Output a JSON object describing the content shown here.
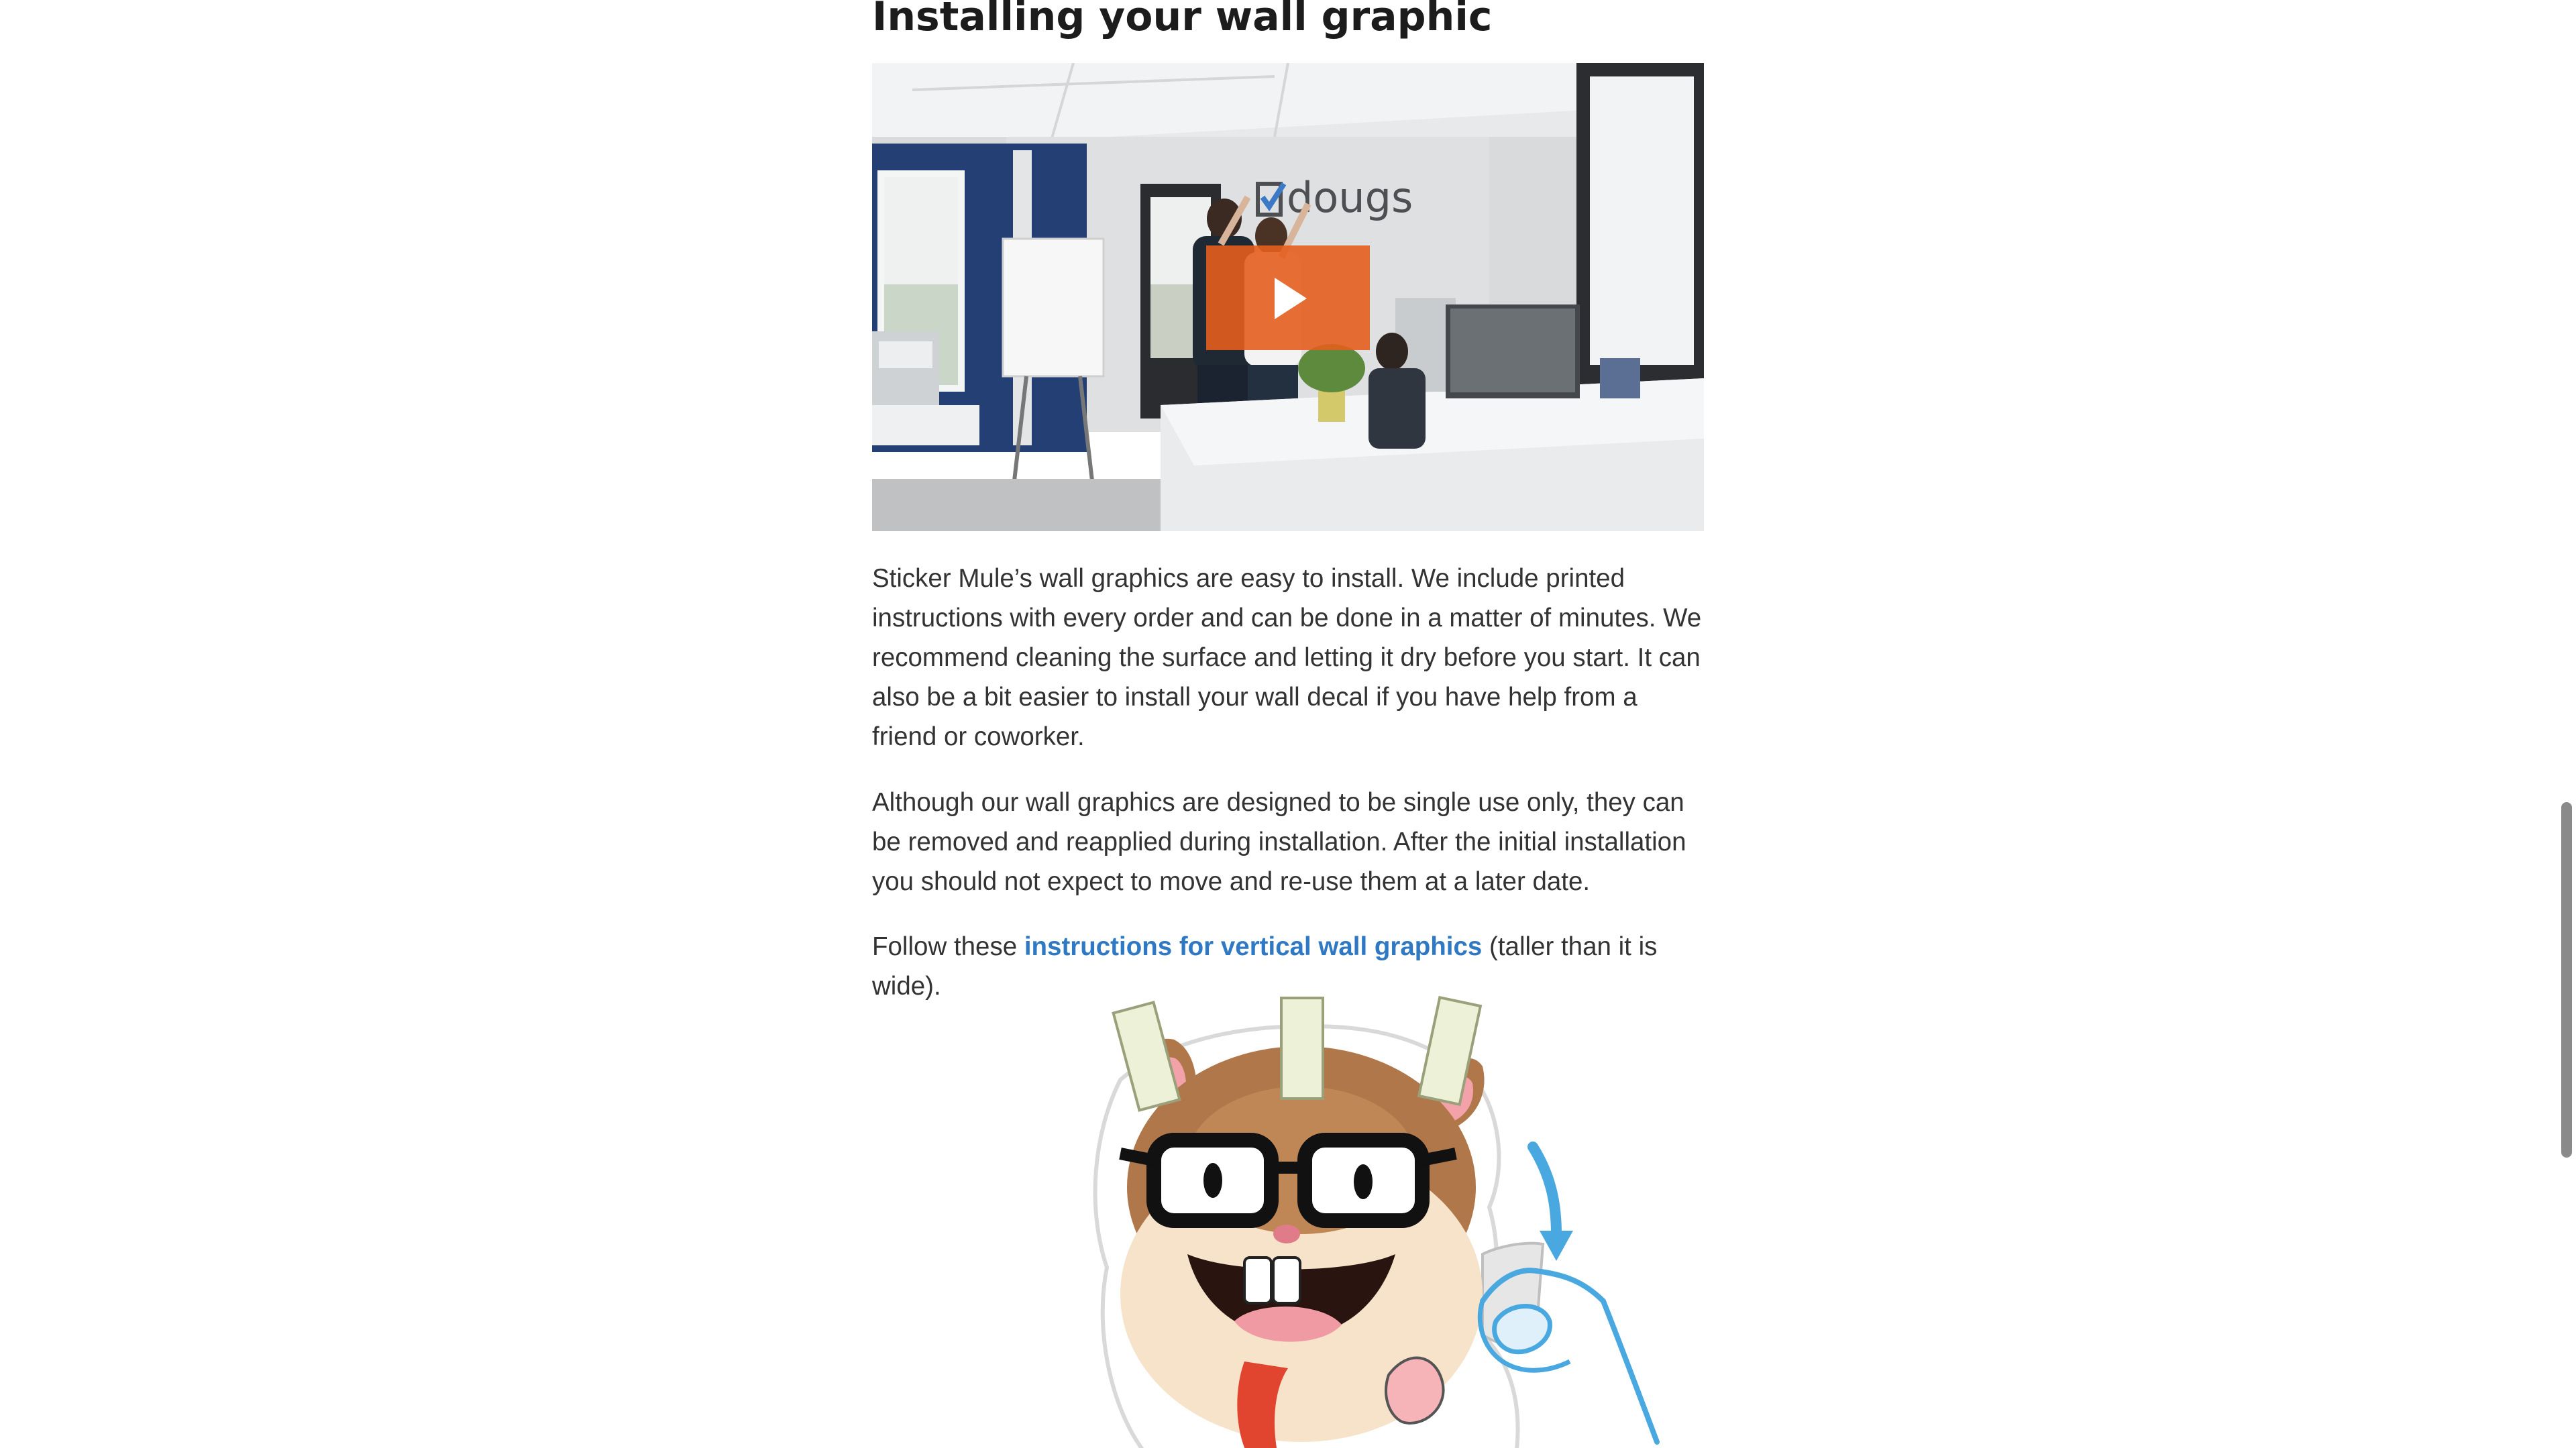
{
  "article": {
    "heading": "Installing your wall graphic",
    "video": {
      "description_sign": "doogs",
      "play_icon": "play-icon",
      "play_color": "#e45e1e"
    },
    "paragraph1": "Sticker Mule’s wall graphics are easy to install. We include printed instructions with every order and can be done in a matter of minutes. We recommend cleaning the surface and letting it dry before you start. It can also be a bit easier to install your wall decal if you have help from a friend or coworker.",
    "paragraph2": "Although our wall graphics are designed to be single use only, they can be removed and reapplied during installation. After the initial installation you should not expect to move and re-use them at a later date.",
    "paragraph3": {
      "before": "Follow these ",
      "link": "instructions for vertical wall graphics",
      "after": " (taller than it is wide)."
    },
    "link_color": "#2f78c4",
    "mascot": {
      "icon": "hamster-mascot-illustration",
      "arrow_color": "#4aa8e0"
    }
  },
  "scrollbar": {
    "thumb_color": "#8a8a8a"
  }
}
